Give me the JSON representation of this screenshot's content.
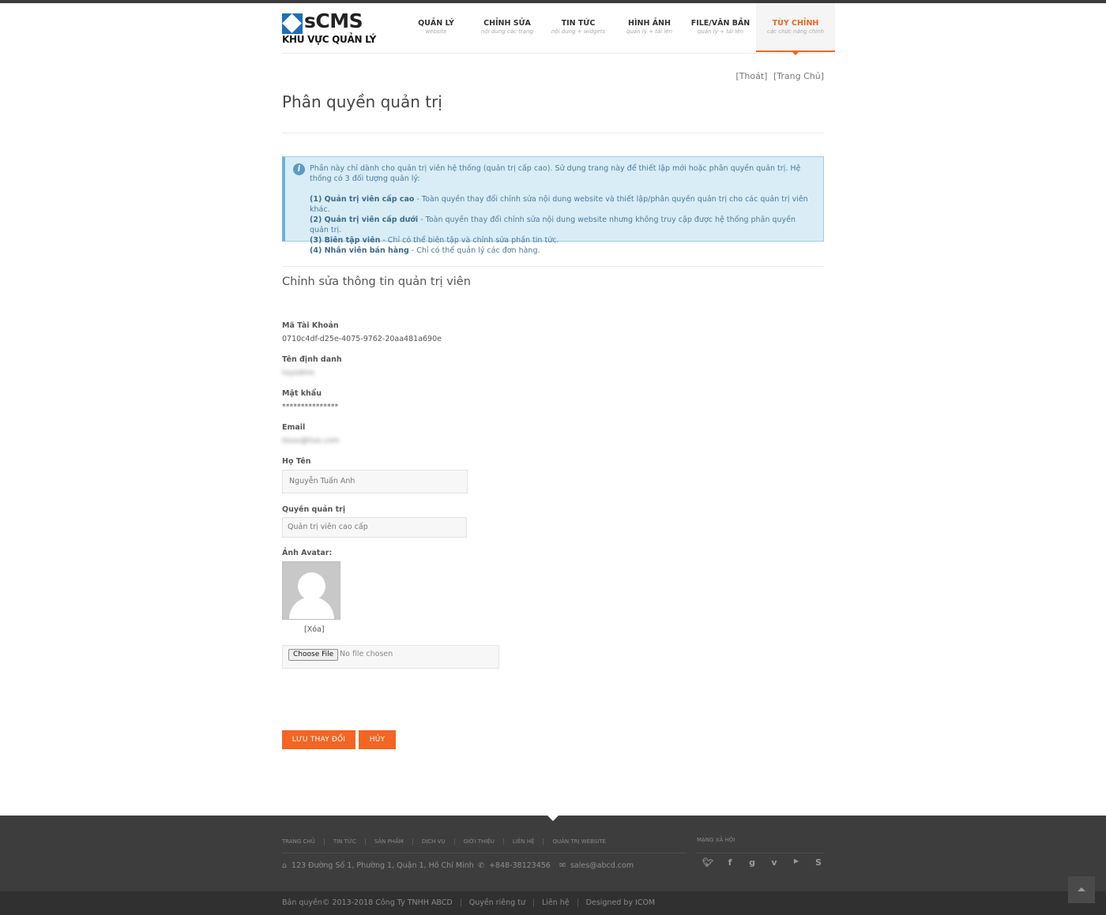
{
  "logo": {
    "text": "sCMS",
    "subtitle": "KHU VỰC QUẢN LÝ"
  },
  "nav": [
    {
      "label": "QUẢN LÝ",
      "sub": "website"
    },
    {
      "label": "CHỈNH SỬA",
      "sub": "nội dung các trang"
    },
    {
      "label": "TIN TỨC",
      "sub": "nội dung + widgets"
    },
    {
      "label": "HÌNH ẢNH",
      "sub": "quản lý + tải lên"
    },
    {
      "label": "FILE/VĂN BẢN",
      "sub": "quản lý + tải lên"
    },
    {
      "label": "TÙY CHỈNH",
      "sub": "các chức năng chính",
      "active": true
    }
  ],
  "toplinks": {
    "logout": "[Thoát]",
    "home": "[Trang Chủ]"
  },
  "page_title": "Phân quyền quản trị",
  "alert": {
    "intro": "Phần này chỉ dành cho quản trị viên hệ thống (quản trị cấp cao). Sử dụng trang này để thiết lập mới hoặc phân quyền quản trị. Hệ thống có 3 đối tượng quản lý:",
    "roles": [
      {
        "name": "(1) Quản trị viên cấp cao",
        "desc": " - Toàn quyền thay đổi chỉnh sửa nội dung website và thiết lập/phân quyền quản trị cho các quản trị viên khác."
      },
      {
        "name": "(2) Quản trị viên cấp dưới",
        "desc": " - Toàn quyền thay đổi chỉnh sửa nội dung website nhưng không truy cập được hệ thống phân quyền quản trị."
      },
      {
        "name": "(3) Biên tập viên",
        "desc": " - Chỉ có thể biên tập và chỉnh sửa phần tin tức."
      },
      {
        "name": "(4) Nhân viên bán hàng",
        "desc": " - Chỉ có thể quản lý các đơn hàng."
      }
    ]
  },
  "section_title": "Chỉnh sửa thông tin quản trị viên",
  "form": {
    "account_id_label": "Mã Tài Khoản",
    "account_id_value": "0710c4df-d25e-4075-9762-20aa481a690e",
    "username_label": "Tên định danh",
    "username_value": "txyzdmn",
    "password_label": "Mật khẩu",
    "password_value": "***************",
    "email_label": "Email",
    "email_value": "tlxxx@live.com",
    "fullname_label": "Họ Tên",
    "fullname_value": "Nguyễn Tuấn Anh",
    "role_label": "Quyền quản trị",
    "role_value": "Quản trị viên cao cấp",
    "avatar_label": "Ảnh Avatar:",
    "avatar_delete": "[Xóa]",
    "file_button": "Choose File",
    "file_status": "No file chosen"
  },
  "buttons": {
    "save": "LƯU THAY ĐỔI",
    "cancel": "HỦY"
  },
  "footer": {
    "links": [
      "TRANG CHỦ",
      "TIN TỨC",
      "SẢN PHẨM",
      "DỊCH VỤ",
      "GIỚI THIỆU",
      "LIÊN HỆ",
      "QUẢN TRỊ WEBSITE"
    ],
    "address": "123 Đường Số 1, Phường 1, Quận 1, Hồ Chí Minh",
    "phone": "+848-38123456",
    "email": "sales@abcd.com",
    "social_title": "MẠNG XÃ HỘI",
    "copyright": "Bản quyền© 2013-2018 Công Ty TNHH ABCD",
    "privacy": "Quyền riêng tư",
    "contact": "Liên hệ",
    "designed": "Designed by ICOM"
  },
  "colors": {
    "accent": "#f26522",
    "brand": "#1e6fb8",
    "footer": "#3d3d3d"
  },
  "icons": [
    "home-icon",
    "phone-icon",
    "mail-icon",
    "twitter-icon",
    "facebook-icon",
    "google-plus-icon",
    "vimeo-icon",
    "youtube-icon",
    "skype-icon",
    "back-to-top-icon"
  ]
}
